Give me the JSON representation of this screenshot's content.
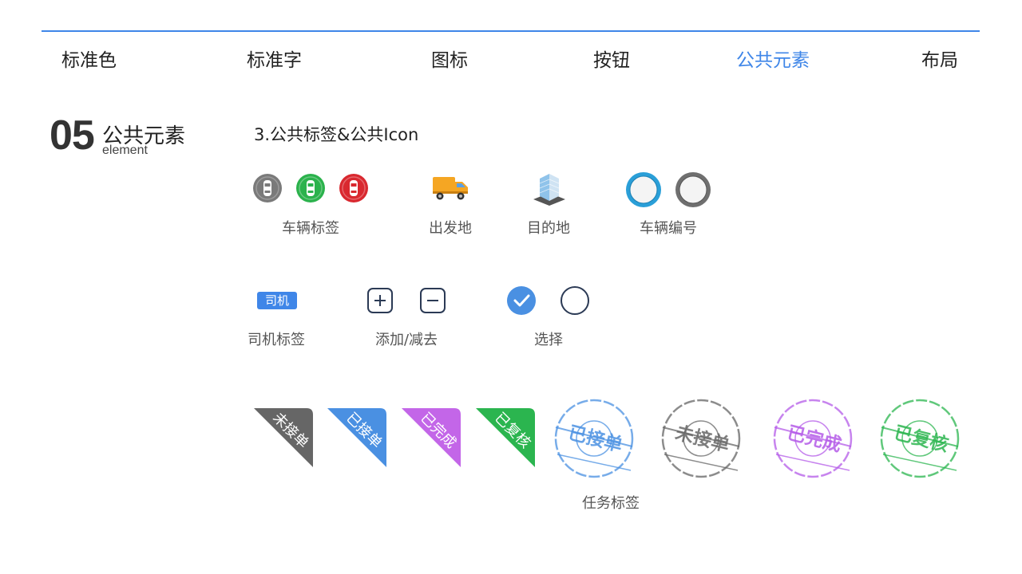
{
  "nav": {
    "items": [
      {
        "label": "标准色",
        "active": false
      },
      {
        "label": "标准字",
        "active": false
      },
      {
        "label": "图标",
        "active": false
      },
      {
        "label": "按钮",
        "active": false
      },
      {
        "label": "公共元素",
        "active": true
      },
      {
        "label": "布局",
        "active": false
      }
    ],
    "accent": "#3f86e8"
  },
  "section": {
    "number": "05",
    "title": "公共元素",
    "subtitle": "element"
  },
  "subsection": "3.公共标签&公共Icon",
  "icons_row1": {
    "vehicle_tag_label": "车辆标签",
    "vehicle_tag_colors": [
      "#7a7a7a",
      "#2bb24c",
      "#d9282f"
    ],
    "origin_label": "出发地",
    "destination_label": "目的地",
    "vehicle_number_label": "车辆编号",
    "vehicle_number_colors": [
      "#2a9fd8",
      "#777777"
    ]
  },
  "icons_row2": {
    "driver_tag_text": "司机",
    "driver_tag_label": "司机标签",
    "add_remove_label": "添加/减去",
    "select_label": "选择"
  },
  "task_tags": {
    "label": "任务标签",
    "corners": [
      {
        "text": "未接单",
        "color": "#666666"
      },
      {
        "text": "已接单",
        "color": "#4a90e2"
      },
      {
        "text": "已完成",
        "color": "#c366e8"
      },
      {
        "text": "已复核",
        "color": "#2bb54f"
      }
    ],
    "stamps": [
      {
        "text": "已接单",
        "color": "#4a90e2"
      },
      {
        "text": "未接单",
        "color": "#666666"
      },
      {
        "text": "已完成",
        "color": "#b45be8"
      },
      {
        "text": "已复核",
        "color": "#2bb54f"
      }
    ]
  }
}
